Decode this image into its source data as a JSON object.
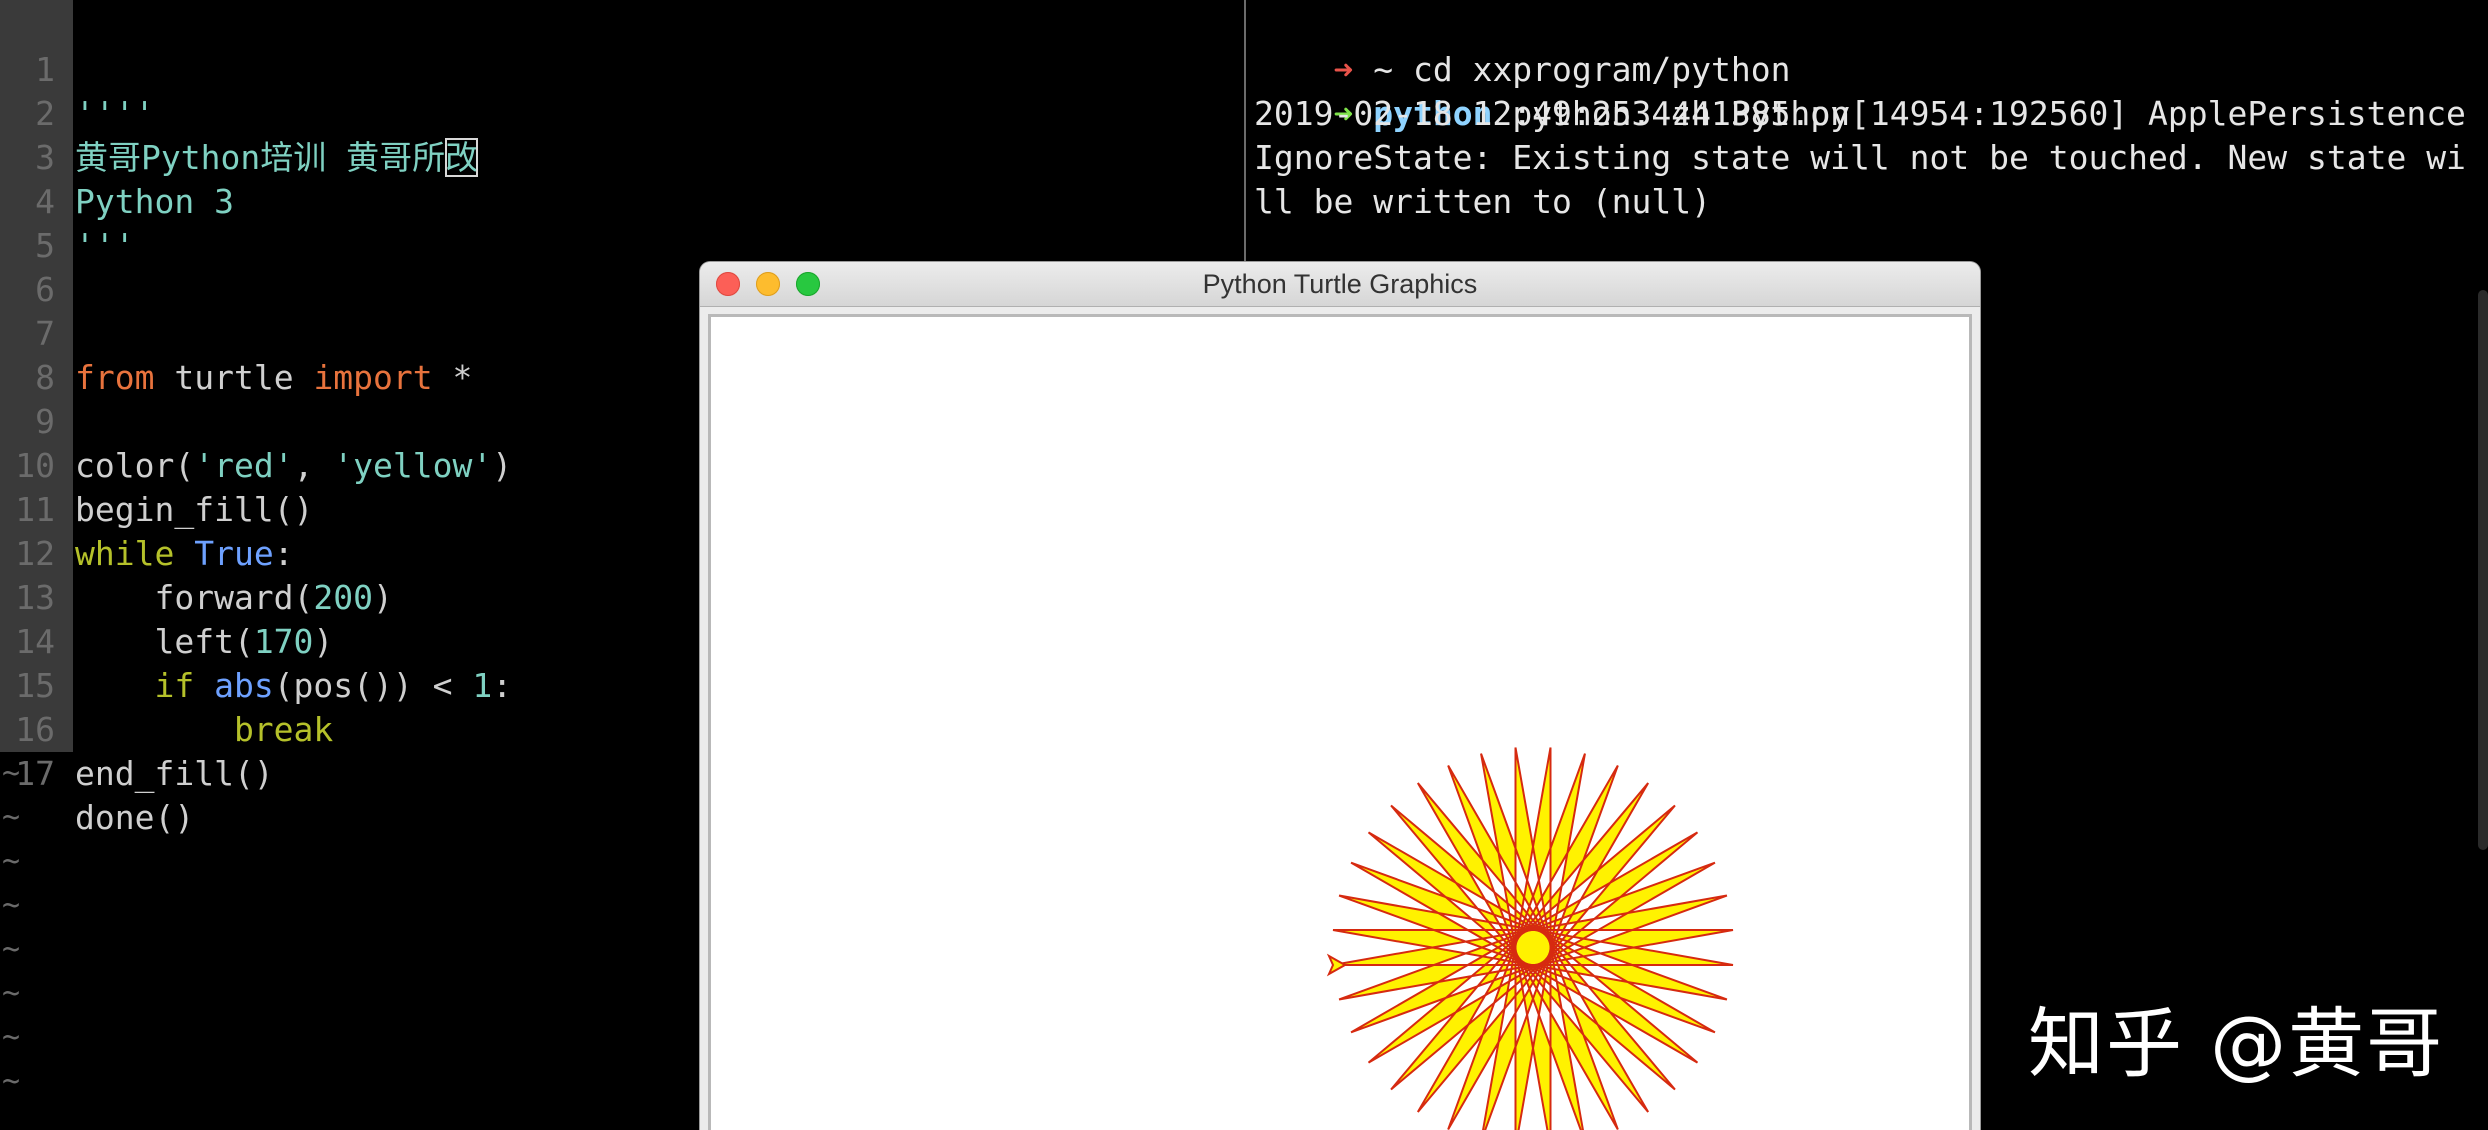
{
  "editor": {
    "lines": [
      {
        "n": "1",
        "text": "''''"
      },
      {
        "n": "2",
        "text": "黄哥Python培训 黄哥所改"
      },
      {
        "n": "3",
        "text": "Python 3"
      },
      {
        "n": "4",
        "text": "'''"
      },
      {
        "n": "5",
        "text": ""
      },
      {
        "n": "6",
        "text": ""
      },
      {
        "n": "7",
        "text": "from turtle import *"
      },
      {
        "n": "8",
        "text": ""
      },
      {
        "n": "9",
        "text": "color('red', 'yellow')"
      },
      {
        "n": "10",
        "text": "begin_fill()"
      },
      {
        "n": "11",
        "text": "while True:"
      },
      {
        "n": "12",
        "text": "    forward(200)"
      },
      {
        "n": "13",
        "text": "    left(170)"
      },
      {
        "n": "14",
        "text": "    if abs(pos()) < 1:"
      },
      {
        "n": "15",
        "text": "        break"
      },
      {
        "n": "16",
        "text": "end_fill()"
      },
      {
        "n": "17",
        "text": "done()"
      }
    ],
    "tokens": {
      "l1": "''''",
      "l2a": "黄哥Python培训 黄哥所",
      "l2cursor": "改",
      "l3": "Python 3",
      "l4": "'''",
      "l7_from": "from",
      "l7_mid": " turtle ",
      "l7_import": "import",
      "l7_star": " *",
      "l9_a": "color(",
      "l9_red": "'red'",
      "l9_comma": ", ",
      "l9_yellow": "'yellow'",
      "l9_close": ")",
      "l10": "begin_fill()",
      "l11_while": "while",
      "l11_sp": " ",
      "l11_true": "True",
      "l11_colon": ":",
      "l12_a": "    forward(",
      "l12_num": "200",
      "l12_close": ")",
      "l13_a": "    left(",
      "l13_num": "170",
      "l13_close": ")",
      "l14_if": "    if ",
      "l14_abs": "abs",
      "l14_mid": "(pos()) < ",
      "l14_num": "1",
      "l14_colon": ":",
      "l15": "        break",
      "l16": "end_fill()",
      "l17": "done()"
    },
    "tilde": "~"
  },
  "terminal": {
    "prompt_arrow": "➜",
    "line1_dir": " ~ ",
    "line1_cmd": "cd xxprogram/python",
    "line2_dir": " python ",
    "line2_cmd": "python3 zh1385.py",
    "output": [
      "2019-02-18 12:49:25.444 Python[14954:192560] ApplePersistence",
      "IgnoreState: Existing state will not be touched. New state wi",
      "ll be written to (null)"
    ]
  },
  "turtle_window": {
    "title": "Python Turtle Graphics",
    "fill_color": "#fff200",
    "stroke_color": "#d62a10",
    "forward": 200,
    "turn": 170
  },
  "watermark": "知乎 @黄哥",
  "colors": {
    "background": "#000000",
    "gutter": "#3a3a3a",
    "keyword": "#e8733d",
    "string": "#7fd1c2",
    "builtin": "#6ea1ff"
  }
}
